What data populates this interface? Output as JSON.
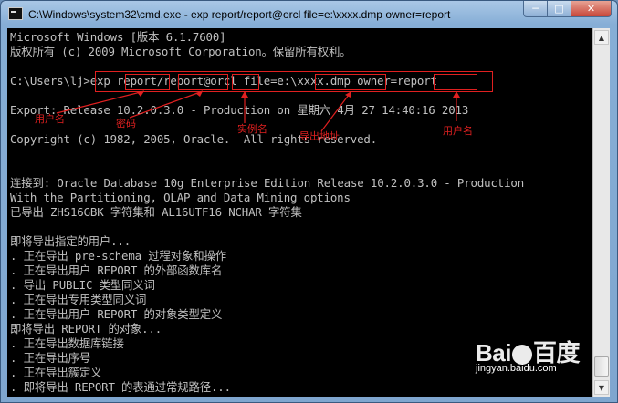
{
  "window": {
    "title": "C:\\Windows\\system32\\cmd.exe - exp  report/report@orcl file=e:\\xxxx.dmp owner=report",
    "controls": {
      "minimize": "─",
      "maximize": "□",
      "close": "✕"
    }
  },
  "console": {
    "lines": [
      "Microsoft Windows [版本 6.1.7600]",
      "版权所有 (c) 2009 Microsoft Corporation。保留所有权利。",
      "",
      "C:\\Users\\lj>exp report/report@orcl file=e:\\xxxx.dmp owner=report",
      "",
      "Export: Release 10.2.0.3.0 - Production on 星期六 4月 27 14:40:16 2013",
      "",
      "Copyright (c) 1982, 2005, Oracle.  All rights reserved.",
      "",
      "",
      "连接到: Oracle Database 10g Enterprise Edition Release 10.2.0.3.0 - Production",
      "With the Partitioning, OLAP and Data Mining options",
      "已导出 ZHS16GBK 字符集和 AL16UTF16 NCHAR 字符集",
      "",
      "即将导出指定的用户...",
      ". 正在导出 pre-schema 过程对象和操作",
      ". 正在导出用户 REPORT 的外部函数库名",
      ". 导出 PUBLIC 类型同义词",
      ". 正在导出专用类型同义词",
      ". 正在导出用户 REPORT 的对象类型定义",
      "即将导出 REPORT 的对象...",
      ". 正在导出数据库链接",
      ". 正在导出序号",
      ". 正在导出簇定义",
      ". 即将导出 REPORT 的表通过常规路径..."
    ]
  },
  "annotations": {
    "username1": "用户名",
    "password": "密码",
    "instance": "实例名",
    "export_path": "导出地址",
    "username2": "用户名",
    "color": "#e02020"
  },
  "scrollbar": {
    "up": "▲",
    "down": "▼"
  },
  "watermark": {
    "logo_left": "Bai",
    "logo_right": "百度",
    "url": "jingyan.baidu.com"
  }
}
